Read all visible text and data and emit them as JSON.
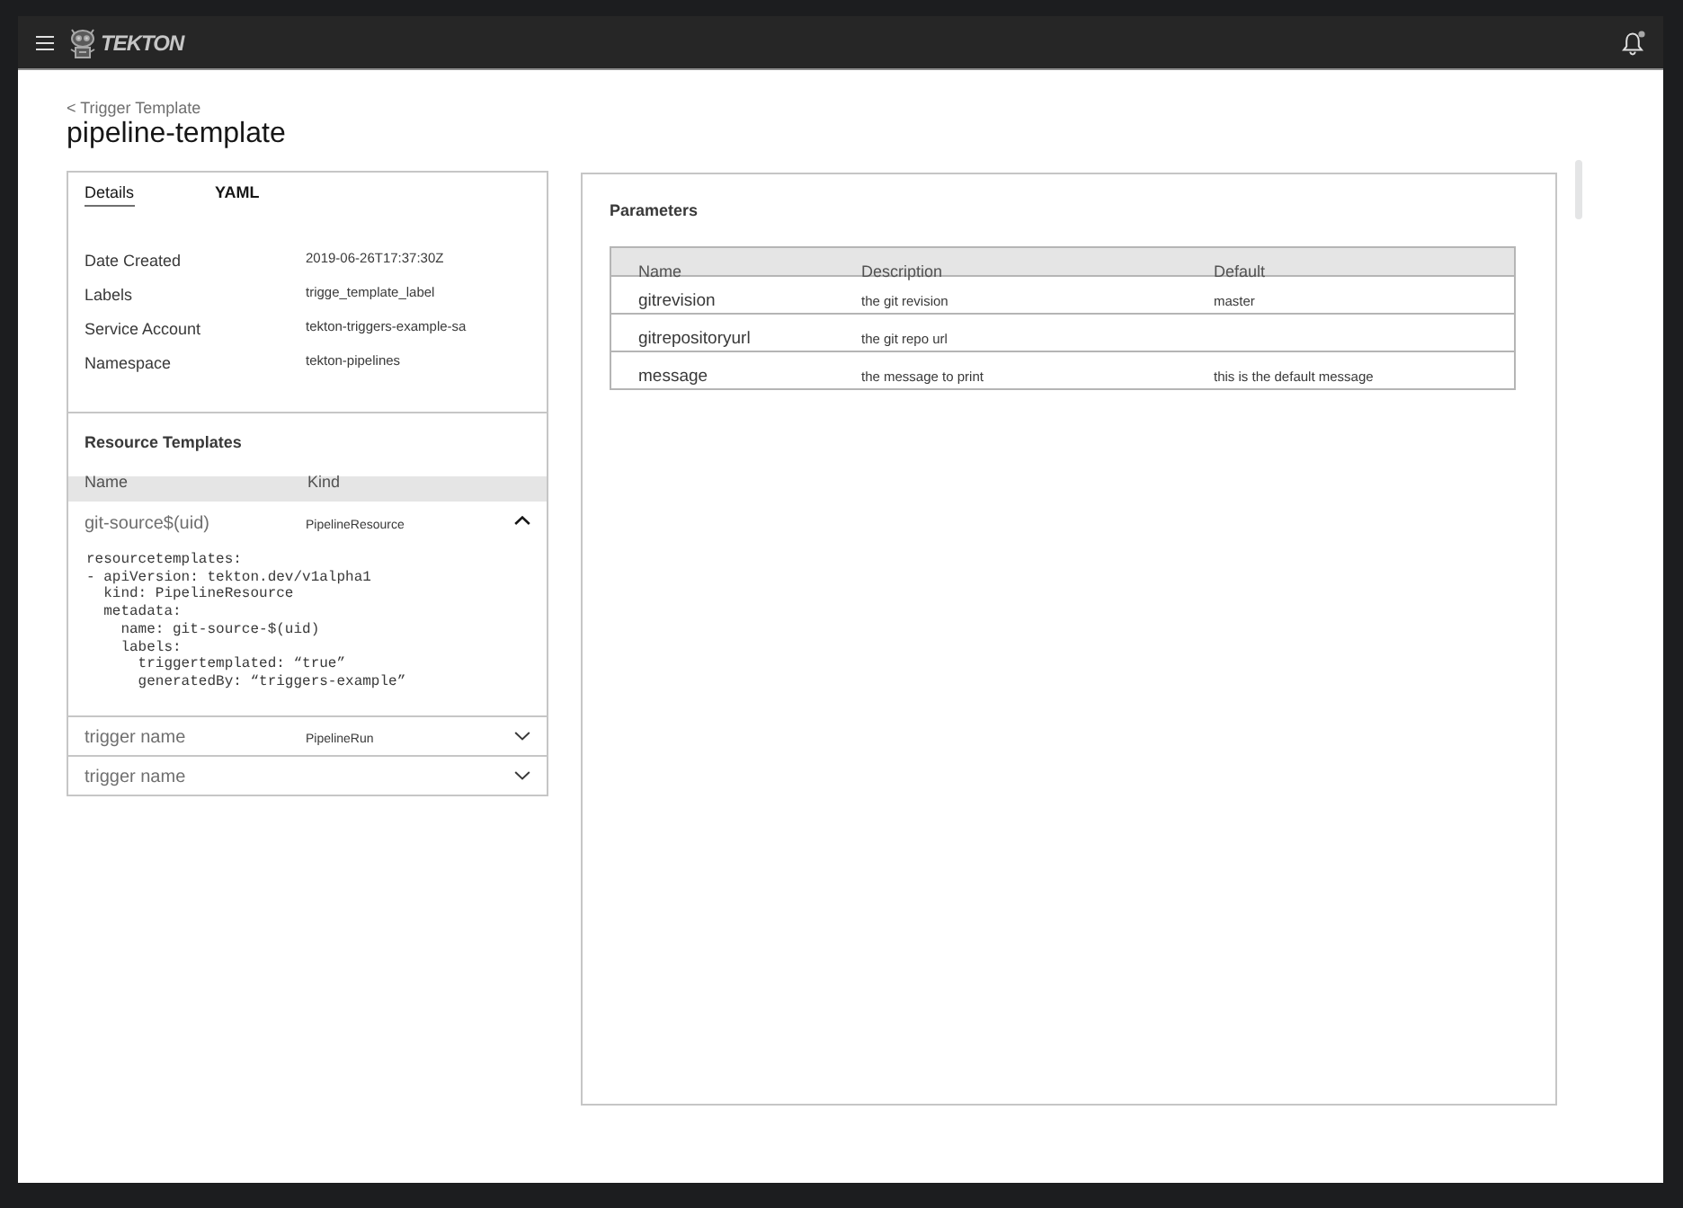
{
  "header": {
    "brand": "TEKTON"
  },
  "breadcrumb": "< Trigger Template",
  "title": "pipeline-template",
  "details": {
    "tabs": [
      {
        "label": "Details",
        "selected": true
      },
      {
        "label": "YAML",
        "selected": false
      }
    ],
    "fields": [
      {
        "label": "Date Created",
        "value": "2019-06-26T17:37:30Z"
      },
      {
        "label": "Labels",
        "value": "trigge_template_label"
      },
      {
        "label": "Service Account",
        "value": "tekton-triggers-example-sa"
      },
      {
        "label": "Namespace",
        "value": "tekton-pipelines"
      }
    ]
  },
  "resource_templates": {
    "title": "Resource Templates",
    "columns": [
      "Name",
      "Kind"
    ],
    "rows": [
      {
        "name": "git-source$(uid)",
        "resource_kind": "PipelineResource",
        "expanded": true,
        "yaml": "resourcetemplates:\n- apiVersion: tekton.dev/v1alpha1\n  kind: PipelineResource\n  metadata:\n    name: git-source-$(uid)\n    labels:\n      triggertemplated: “true”\n      generatedBy: “triggers-example”"
      },
      {
        "name": "trigger name",
        "resource_kind": "PipelineRun",
        "expanded": false
      },
      {
        "name": "trigger name",
        "expanded": false
      }
    ]
  },
  "parameters": {
    "title": "Parameters",
    "columns": [
      "Name",
      "Description",
      "Default"
    ],
    "rows": [
      {
        "name": "gitrevision",
        "description": "the git revision",
        "default": "master"
      },
      {
        "name": "gitrepositoryurl",
        "description": "the git repo url"
      },
      {
        "name": "message",
        "description": "the message to print",
        "default": "this is the default message"
      }
    ]
  }
}
